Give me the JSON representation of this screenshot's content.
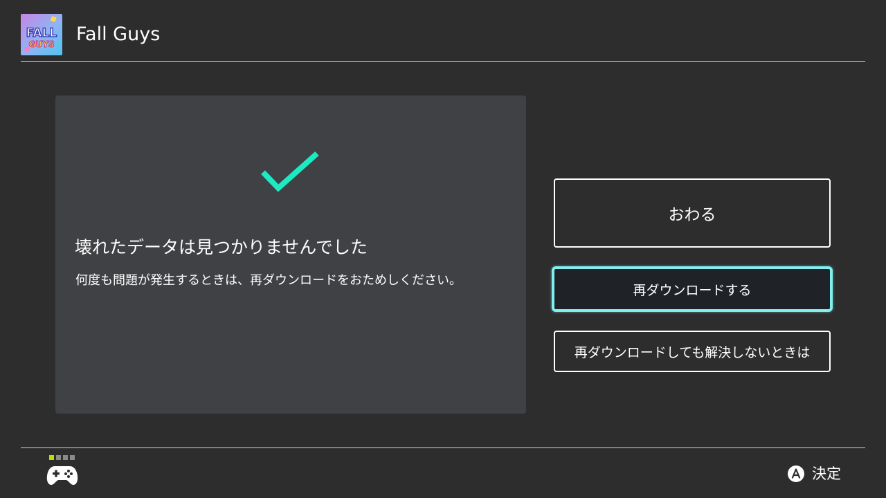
{
  "header": {
    "game_title": "Fall Guys",
    "game_icon": "fall-guys-game-icon",
    "icon_logo_text_top": "FALL",
    "icon_logo_text_bottom": "GUYS"
  },
  "panel": {
    "status_icon": "checkmark-icon",
    "heading": "壊れたデータは見つかりませんでした",
    "message": "何度も問題が発生するときは、再ダウンロードをおためしください。"
  },
  "actions": {
    "exit_label": "おわる",
    "redownload_label": "再ダウンロードする",
    "help_label": "再ダウンロードしても解決しないときは"
  },
  "footer": {
    "controller_icon": "gamepad-icon",
    "players_connected": 1,
    "players_total": 4,
    "confirm_button_icon": "a-button-icon",
    "confirm_label": "決定"
  },
  "colors": {
    "background": "#2d2d2d",
    "panel": "#404144",
    "accent_check": "#1de9c3",
    "focus_border": "#7feff0",
    "player_active": "#b4e100"
  }
}
